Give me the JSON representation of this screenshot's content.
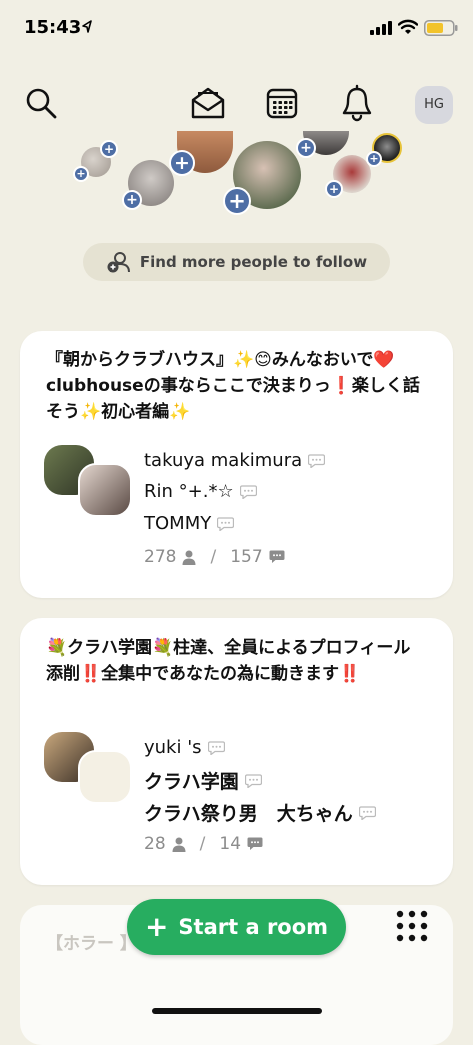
{
  "status_bar": {
    "time": "15:43"
  },
  "header": {
    "profile_initials": "HG"
  },
  "find_people_label": "Find more people to follow",
  "rooms": [
    {
      "title": "『朝からクラブハウス』✨😊みんなおいで❤️clubhouseの事ならここで決まりっ❗️楽しく話そう✨初心者編✨",
      "speakers": [
        "takuya makimura",
        "Rin °+.*☆",
        "TOMMY"
      ],
      "listeners": "278",
      "speaker_count": "157"
    },
    {
      "title": "💐クラハ学園💐柱達、全員によるプロフィール添削‼️全集中であなたの為に動きます‼️",
      "speakers": [
        "yuki 's",
        "クラハ学園",
        "クラハ祭り男　大ちゃん"
      ],
      "listeners": "28",
      "speaker_count": "14"
    },
    {
      "title_partial": "【ホラー                                】【怪"
    }
  ],
  "start_room_label": "Start a room",
  "colors": {
    "background": "#f1efe4",
    "accent_green": "#27ad60",
    "plus_blue": "#4e6ea5"
  }
}
